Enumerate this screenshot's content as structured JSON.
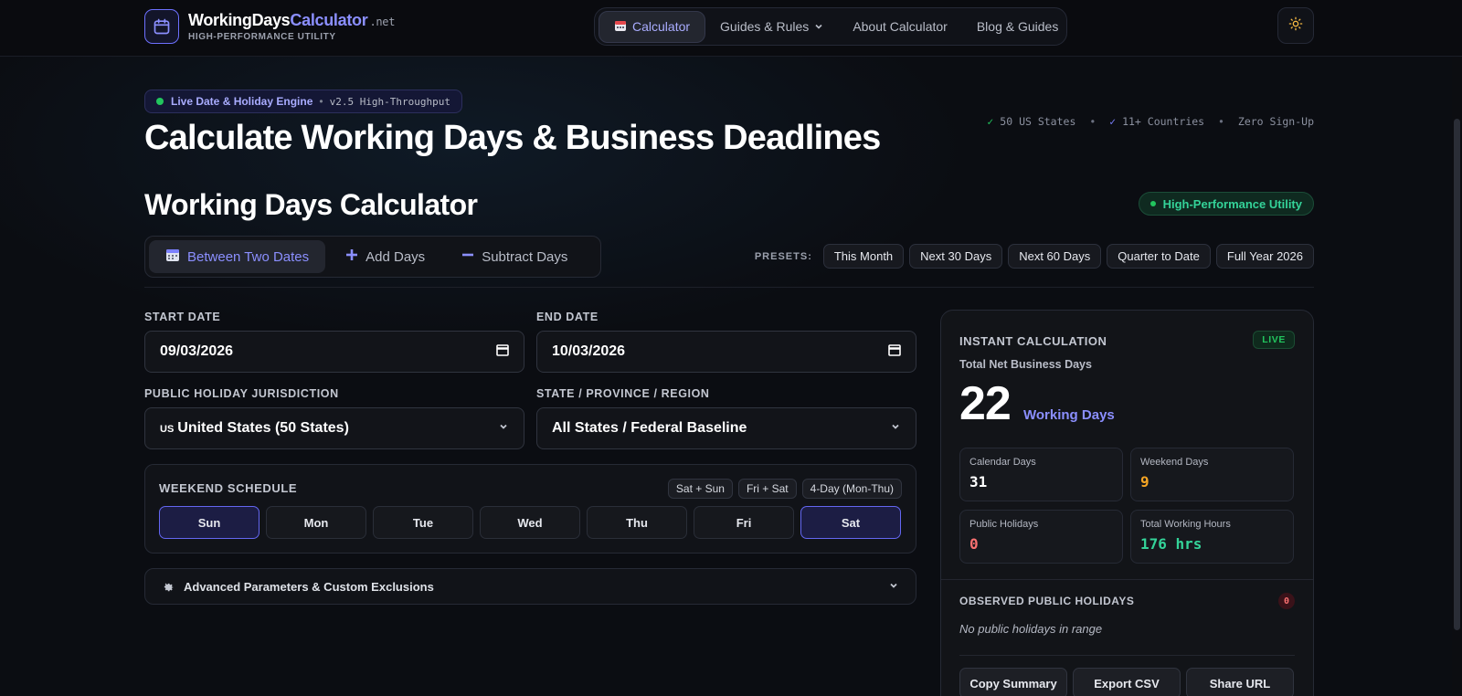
{
  "brand": {
    "name_main": "WorkingDays",
    "name_accent": "Calculator",
    "tld": ".net",
    "subtitle": "HIGH-PERFORMANCE UTILITY"
  },
  "nav": {
    "items": [
      {
        "label": "Calculator",
        "icon": "calendar-emoji-icon",
        "active": true
      },
      {
        "label": "Guides & Rules",
        "icon": "chevron-down-icon"
      },
      {
        "label": "About Calculator"
      },
      {
        "label": "Blog & Guides"
      }
    ],
    "theme_icon": "sun-icon"
  },
  "hero": {
    "badge_main": "Live Date & Holiday Engine",
    "badge_sep": "•",
    "badge_version": "v2.5 High-Throughput",
    "title": "Calculate Working Days & Business Deadlines",
    "trust": [
      "50 US States",
      "11+ Countries",
      "Zero Sign-Up"
    ],
    "trust_check": "✓",
    "trust_dot": "•"
  },
  "calculator": {
    "title": "Working Days Calculator",
    "badge": "High-Performance Utility",
    "modes": [
      {
        "label": "Between Two Dates",
        "icon": "calendar-icon",
        "active": true
      },
      {
        "label": "Add Days",
        "icon": "plus-icon"
      },
      {
        "label": "Subtract Days",
        "icon": "minus-icon"
      }
    ],
    "presets_label": "PRESETS:",
    "presets": [
      "This Month",
      "Next 30 Days",
      "Next 60 Days",
      "Quarter to Date",
      "Full Year 2026"
    ],
    "start_label": "START DATE",
    "start_value": "09/03/2026",
    "end_label": "END DATE",
    "end_value": "10/03/2026",
    "jurisdiction_label": "PUBLIC HOLIDAY JURISDICTION",
    "jurisdiction_code": "US",
    "jurisdiction_value": "United States (50 States)",
    "region_label": "STATE / PROVINCE / REGION",
    "region_value": "All States / Federal Baseline",
    "weekend": {
      "title": "WEEKEND SCHEDULE",
      "presets": [
        "Sat + Sun",
        "Fri + Sat",
        "4-Day (Mon-Thu)"
      ],
      "days": [
        {
          "label": "Sun",
          "selected": true
        },
        {
          "label": "Mon",
          "selected": false
        },
        {
          "label": "Tue",
          "selected": false
        },
        {
          "label": "Wed",
          "selected": false
        },
        {
          "label": "Thu",
          "selected": false
        },
        {
          "label": "Fri",
          "selected": false
        },
        {
          "label": "Sat",
          "selected": true
        }
      ]
    },
    "advanced_label": "Advanced Parameters & Custom Exclusions"
  },
  "results": {
    "heading": "INSTANT CALCULATION",
    "live_badge": "LIVE",
    "net_label": "Total Net Business Days",
    "net_value": "22",
    "net_unit": "Working Days",
    "stats": [
      {
        "label": "Calendar Days",
        "value": "31",
        "color": "#ffffff"
      },
      {
        "label": "Weekend Days",
        "value": "9",
        "color": "#f5a524"
      },
      {
        "label": "Public Holidays",
        "value": "0",
        "color": "#f87171"
      },
      {
        "label": "Total Working Hours",
        "value": "176 hrs",
        "color": "#34d399"
      }
    ],
    "holidays_title": "OBSERVED PUBLIC HOLIDAYS",
    "holidays_count": "0",
    "holidays_empty": "No public holidays in range",
    "actions": [
      "Copy Summary",
      "Export CSV",
      "Share URL"
    ]
  },
  "colors": {
    "accent": "#8b8fff",
    "success": "#22c55e",
    "warning": "#f5a524",
    "danger": "#f87171",
    "background": "#0b0d12"
  }
}
